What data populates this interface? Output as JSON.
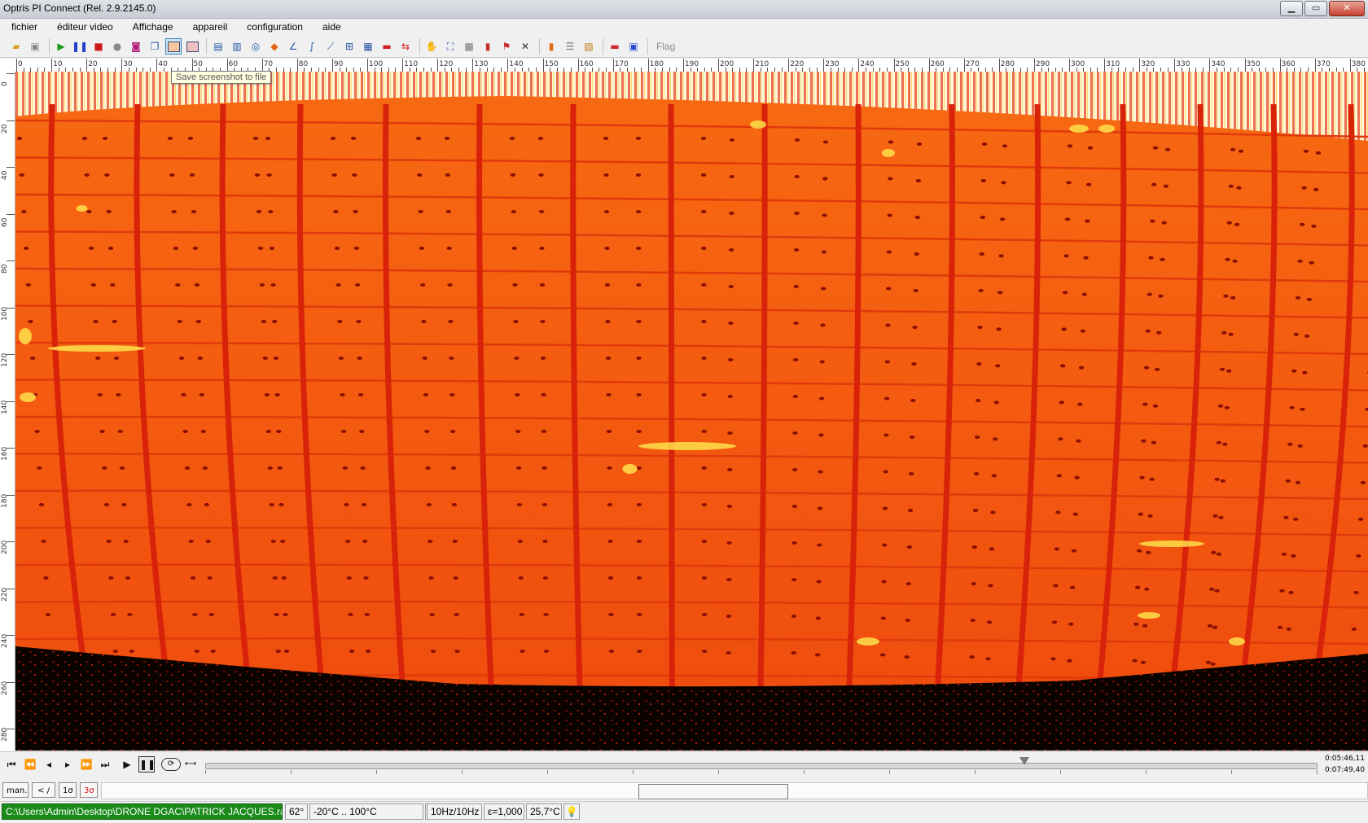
{
  "window": {
    "title": "Optris PI Connect (Rel. 2.9.2145.0)"
  },
  "menu": {
    "items": [
      "fichier",
      "éditeur video",
      "Affichage",
      "appareil",
      "configuration",
      "aide"
    ]
  },
  "toolbar": {
    "flag_label": "Flag",
    "tooltip": "Save screenshot to file",
    "icons": [
      "open-file-icon",
      "save-icon",
      "play-icon",
      "pause-icon",
      "stop-icon",
      "record-icon",
      "camera-snapshot-icon",
      "copy-icon",
      "save-screenshot-icon",
      "export-image-icon",
      "profile-icon",
      "histogram-icon",
      "camera-icon",
      "palette-icon",
      "graph-icon",
      "chart-icon",
      "line-chart-icon",
      "area-icon",
      "grid-icon",
      "colorbar-icon",
      "measure-icon",
      "hand-icon",
      "zoom-fit-icon",
      "layout-icon",
      "palette-bars-icon",
      "flags-icon",
      "tools-icon",
      "color-scale-icon",
      "scale-icon",
      "stripes-icon",
      "layout-red-icon",
      "layout-blue-icon"
    ],
    "accent": "#3c7fb1"
  },
  "ruler": {
    "x_labels": [
      "0",
      "10",
      "20",
      "30",
      "40",
      "50",
      "60",
      "70",
      "80",
      "90",
      "100",
      "110",
      "120",
      "130",
      "140",
      "150",
      "160",
      "170",
      "180",
      "190",
      "200",
      "210",
      "220",
      "230",
      "240",
      "250",
      "260",
      "270",
      "280",
      "290",
      "300",
      "310",
      "320",
      "330",
      "340",
      "350",
      "360",
      "370",
      "380"
    ],
    "y_labels": [
      "0",
      "20",
      "40",
      "60",
      "80",
      "100",
      "120",
      "140",
      "160",
      "180",
      "200",
      "220",
      "240",
      "260",
      "280"
    ]
  },
  "playback": {
    "time_current": "0:05:46,11",
    "time_total": "0:07:49,40",
    "position_fraction": 0.7375
  },
  "lower": {
    "man_label": "man.",
    "nav_label": "< / >",
    "sigma1_label": "1σ",
    "sigma3_label": "3σ"
  },
  "status": {
    "path": "C:\\Users\\Admin\\Desktop\\DRONE DGAC\\PATRICK JACQUES.ravi",
    "fov": "62°",
    "range": "-20°C .. 100°C",
    "empty": "",
    "rate": "10Hz/10Hz",
    "emissivity": "ε=1,000",
    "temperature": "25,7°C"
  },
  "colors": {
    "status_green": "#1a8a1a",
    "thermal_base": "#f0520f",
    "thermal_hot": "#ffe14a"
  }
}
